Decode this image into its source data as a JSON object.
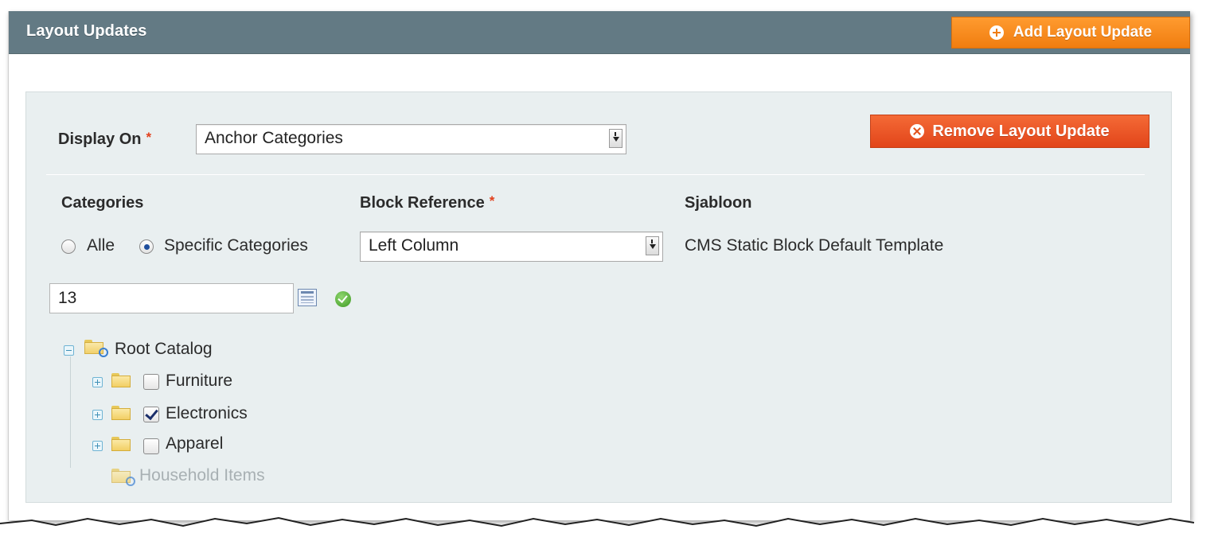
{
  "header": {
    "title": "Layout Updates",
    "add_button_label": "Add Layout Update"
  },
  "form": {
    "display_on_label": "Display On",
    "display_on_value": "Anchor Categories",
    "remove_button_label": "Remove Layout Update",
    "categories_label": "Categories",
    "block_reference_label": "Block Reference",
    "template_label": "Sjabloon",
    "radio_all_label": "Alle",
    "radio_specific_label": "Specific Categories",
    "radio_selected": "Specific Categories",
    "block_reference_value": "Left Column",
    "template_value": "CMS Static Block Default Template",
    "category_ids_value": "13",
    "required_marker": "*"
  },
  "tree": {
    "root": "Root Catalog",
    "items": [
      {
        "label": "Furniture",
        "checked": false
      },
      {
        "label": "Electronics",
        "checked": true
      },
      {
        "label": "Apparel",
        "checked": false
      }
    ],
    "disabled_item": "Household Items"
  },
  "colors": {
    "header_bg": "#637a84",
    "add_button": "#f5891f",
    "remove_button": "#e8511f",
    "panel_bg": "#e9eff0"
  }
}
